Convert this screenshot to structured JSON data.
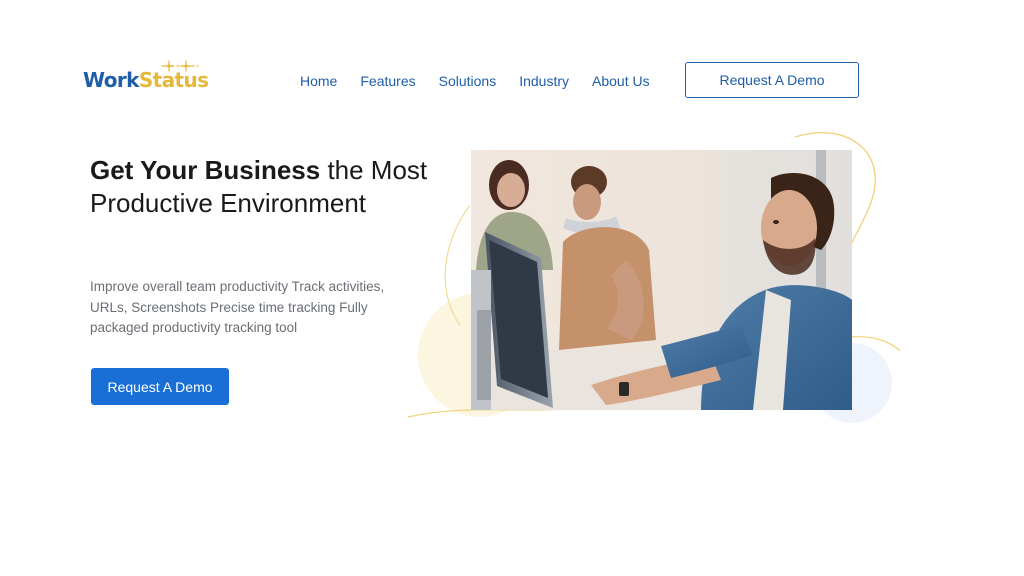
{
  "header": {
    "logo": {
      "part1": "Work",
      "part2": "Status"
    },
    "nav": [
      {
        "label": "Home"
      },
      {
        "label": "Features"
      },
      {
        "label": "Solutions"
      },
      {
        "label": "Industry"
      },
      {
        "label": "About Us"
      }
    ],
    "cta_label": "Request A Demo"
  },
  "hero": {
    "title_strong": "Get Your Business",
    "title_rest": " the Most Productive Environment",
    "description": "Improve overall team productivity Track activities, URLs, Screenshots Precise time tracking Fully packaged productivity tracking tool",
    "cta_label": "Request A Demo"
  },
  "colors": {
    "brand_blue": "#1f5ea8",
    "button_blue": "#1a6fd6",
    "brand_yellow": "#e5b83a",
    "text_dark": "#1a1a1a",
    "text_muted": "#6a6f75"
  }
}
